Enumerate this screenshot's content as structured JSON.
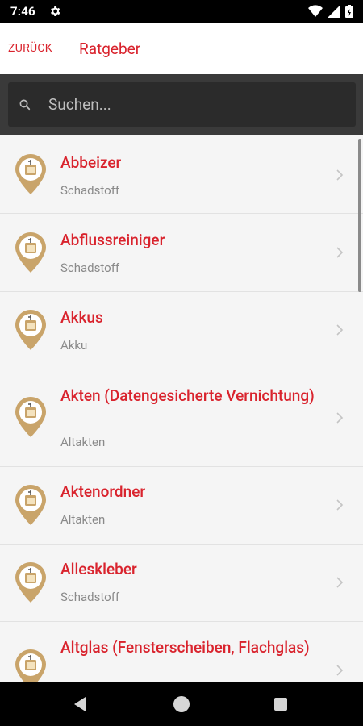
{
  "status_bar": {
    "time": "7:46",
    "icons": [
      "gear-icon",
      "wifi-icon",
      "signal-icon",
      "battery-icon"
    ]
  },
  "header": {
    "back_label": "ZURÜCK",
    "title": "Ratgeber"
  },
  "search": {
    "placeholder": "Suchen..."
  },
  "list": {
    "items": [
      {
        "title": "Abbeizer",
        "subtitle": "Schadstoff"
      },
      {
        "title": "Abflussreiniger",
        "subtitle": "Schadstoff"
      },
      {
        "title": "Akkus",
        "subtitle": "Akku"
      },
      {
        "title": "Akten (Datengesicherte Vernichtung)",
        "subtitle": "Altakten"
      },
      {
        "title": "Aktenordner",
        "subtitle": "Altakten"
      },
      {
        "title": "Alleskleber",
        "subtitle": "Schadstoff"
      },
      {
        "title": "Altglas (Fensterscheiben, Flachglas)",
        "subtitle": ""
      }
    ]
  },
  "colors": {
    "accent": "#d9232d",
    "pin": "#c9a46a",
    "search_bg": "#3a3a3a"
  },
  "nav_bar": {
    "icons": [
      "back-triangle-icon",
      "home-circle-icon",
      "recents-square-icon"
    ]
  }
}
